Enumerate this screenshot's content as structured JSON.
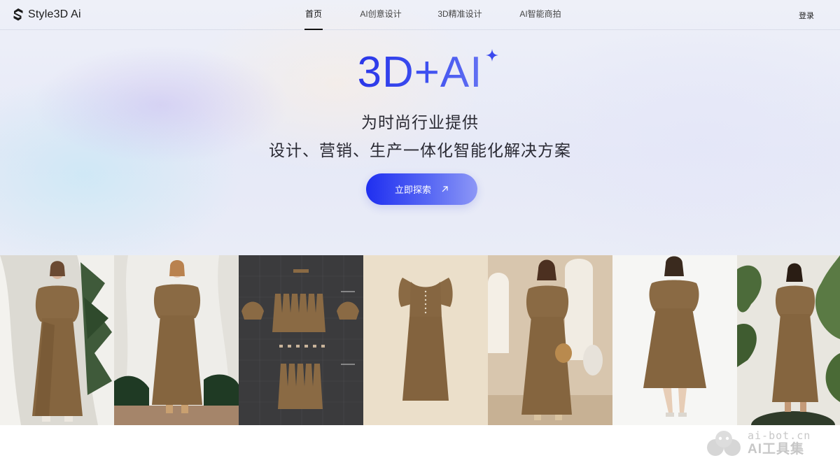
{
  "header": {
    "logo_text": "Style3D Ai",
    "nav": [
      {
        "label": "首页",
        "active": true
      },
      {
        "label": "AI创意设计",
        "active": false
      },
      {
        "label": "3D精准设计",
        "active": false
      },
      {
        "label": "AI智能商拍",
        "active": false
      }
    ],
    "login_label": "登录"
  },
  "hero": {
    "headline": "3D+AI",
    "subline_1": "为时尚行业提供",
    "subline_2": "设计、营销、生产一体化智能化解决方案",
    "cta_label": "立即探索",
    "colors": {
      "accent_start": "#1f2ff0",
      "accent_end": "#8d97f6",
      "headline": "#2a36e8"
    }
  },
  "gallery": {
    "panels": [
      {
        "name": "model-outdoor-drapes"
      },
      {
        "name": "model-white-studio"
      },
      {
        "name": "pattern-pieces-layout"
      },
      {
        "name": "dress-3d-render"
      },
      {
        "name": "model-arched-window"
      },
      {
        "name": "model-white-background"
      },
      {
        "name": "model-plants-background"
      }
    ],
    "dress_color": "#8a6a44"
  },
  "watermark": {
    "url": "ai-bot.cn",
    "name": "AI工具集"
  }
}
